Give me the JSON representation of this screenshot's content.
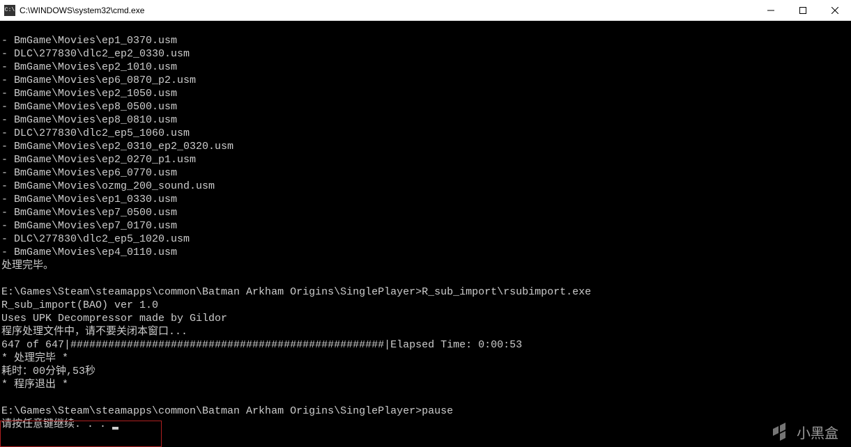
{
  "window": {
    "title": "C:\\WINDOWS\\system32\\cmd.exe",
    "icon_label": "cmd-icon"
  },
  "terminal": {
    "file_lines": [
      "- BmGame\\Movies\\ep1_0370.usm",
      "- DLC\\277830\\dlc2_ep2_0330.usm",
      "- BmGame\\Movies\\ep2_1010.usm",
      "- BmGame\\Movies\\ep6_0870_p2.usm",
      "- BmGame\\Movies\\ep2_1050.usm",
      "- BmGame\\Movies\\ep8_0500.usm",
      "- BmGame\\Movies\\ep8_0810.usm",
      "- DLC\\277830\\dlc2_ep5_1060.usm",
      "- BmGame\\Movies\\ep2_0310_ep2_0320.usm",
      "- BmGame\\Movies\\ep2_0270_p1.usm",
      "- BmGame\\Movies\\ep6_0770.usm",
      "- BmGame\\Movies\\ozmg_200_sound.usm",
      "- BmGame\\Movies\\ep1_0330.usm",
      "- BmGame\\Movies\\ep7_0500.usm",
      "- BmGame\\Movies\\ep7_0170.usm",
      "- DLC\\277830\\dlc2_ep5_1020.usm",
      "- BmGame\\Movies\\ep4_0110.usm"
    ],
    "done_line": "处理完毕。",
    "blank": "",
    "prompt1": "E:\\Games\\Steam\\steamapps\\common\\Batman Arkham Origins\\SinglePlayer>R_sub_import\\rsubimport.exe",
    "tool_name": "R_sub_import(BAO) ver 1.0",
    "tool_credit": "Uses UPK Decompressor made by Gildor",
    "processing": "程序处理文件中，请不要关闭本窗口...",
    "progress": "647 of 647|##################################################|Elapsed Time: 0:00:53",
    "done2": "* 处理完毕 *",
    "elapsed": "耗时：00分钟,53秒",
    "exit": "* 程序退出 *",
    "prompt2": "E:\\Games\\Steam\\steamapps\\common\\Batman Arkham Origins\\SinglePlayer>pause",
    "press_key": "请按任意键继续. . . "
  },
  "watermark": {
    "text": "小黑盒"
  }
}
